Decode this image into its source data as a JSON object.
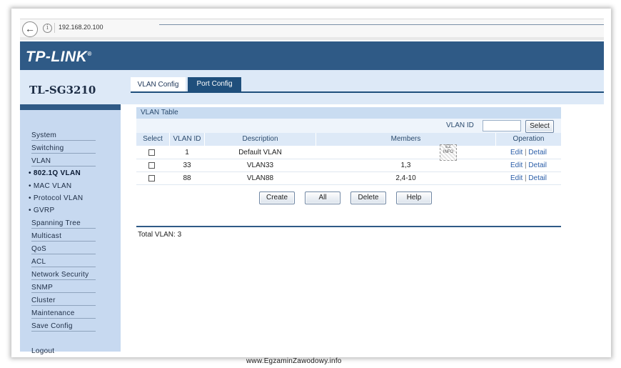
{
  "browser": {
    "back_icon": "back-arrow-icon",
    "info_icon": "info-icon",
    "address": "192.168.20.100"
  },
  "brand": {
    "logo": "TP-LINK",
    "model": "TL-SG3210"
  },
  "tabs": [
    {
      "label": "VLAN Config",
      "active": true
    },
    {
      "label": "Port Config",
      "active": false
    }
  ],
  "sidebar": {
    "items": [
      {
        "label": "System",
        "type": "menu"
      },
      {
        "label": "Switching",
        "type": "menu"
      },
      {
        "label": "VLAN",
        "type": "menu"
      },
      {
        "label": "• 802.1Q VLAN",
        "type": "sub",
        "active": true
      },
      {
        "label": "• MAC VLAN",
        "type": "sub"
      },
      {
        "label": "• Protocol VLAN",
        "type": "sub"
      },
      {
        "label": "• GVRP",
        "type": "sub"
      },
      {
        "label": "Spanning Tree",
        "type": "menu"
      },
      {
        "label": "Multicast",
        "type": "menu"
      },
      {
        "label": "QoS",
        "type": "menu"
      },
      {
        "label": "ACL",
        "type": "menu"
      },
      {
        "label": "Network Security",
        "type": "menu"
      },
      {
        "label": "SNMP",
        "type": "menu"
      },
      {
        "label": "Cluster",
        "type": "menu"
      },
      {
        "label": "Maintenance",
        "type": "menu"
      },
      {
        "label": "Save Config",
        "type": "menu"
      }
    ],
    "logout": "Logout"
  },
  "vlan_table": {
    "title": "VLAN Table",
    "search_label": "VLAN ID",
    "search_value": "",
    "select_button": "Select",
    "columns": [
      "Select",
      "VLAN ID",
      "Description",
      "Members",
      "Operation"
    ],
    "rows": [
      {
        "checked": false,
        "vlan_id": "1",
        "description": "Default VLAN",
        "members": "",
        "edit": "Edit",
        "sep": "|",
        "detail": "Detail"
      },
      {
        "checked": false,
        "vlan_id": "33",
        "description": "VLAN33",
        "members": "1,3",
        "edit": "Edit",
        "sep": "|",
        "detail": "Detail"
      },
      {
        "checked": false,
        "vlan_id": "88",
        "description": "VLAN88",
        "members": "2,4-10",
        "edit": "Edit",
        "sep": "|",
        "detail": "Detail"
      }
    ],
    "qr_text": "EZ INFO",
    "buttons": {
      "create": "Create",
      "all": "All",
      "delete": "Delete",
      "help": "Help"
    },
    "total": "Total VLAN: 3"
  },
  "watermark": "www.EgzaminZawodowy.info"
}
